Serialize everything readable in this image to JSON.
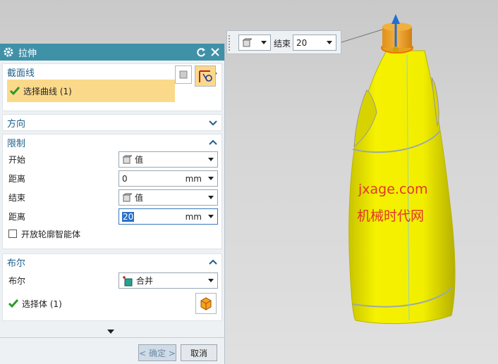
{
  "dialog": {
    "title": "拉伸",
    "sections": {
      "section_curve": {
        "label": "截面线",
        "select_curve": "选择曲线 (1)"
      },
      "direction": {
        "label": "方向"
      },
      "limits": {
        "label": "限制",
        "start_label": "开始",
        "start_value": "值",
        "distance1_label": "距离",
        "distance1_value": "0",
        "distance1_unit": "mm",
        "end_label": "结束",
        "end_value": "值",
        "distance2_label": "距离",
        "distance2_value": "20",
        "distance2_unit": "mm",
        "open_profile_label": "开放轮廓智能体"
      },
      "boolean": {
        "label": "布尔",
        "boolean_label": "布尔",
        "boolean_value": "合并",
        "select_body": "选择体 (1)"
      }
    },
    "ok_label": "< 确定 >",
    "cancel_label": "取消"
  },
  "floating_toolbar": {
    "end_label": "结束",
    "end_value": "20"
  },
  "watermark": {
    "line1": "jxage.com",
    "line2": "机械时代网"
  },
  "colors": {
    "titlebar": "#3f91a8",
    "section_header": "#1f5f8b",
    "selection_highlight": "#fbd98a",
    "model_body": "#f2ee00",
    "model_cap": "#f0a020",
    "watermark": "#e0362a"
  }
}
